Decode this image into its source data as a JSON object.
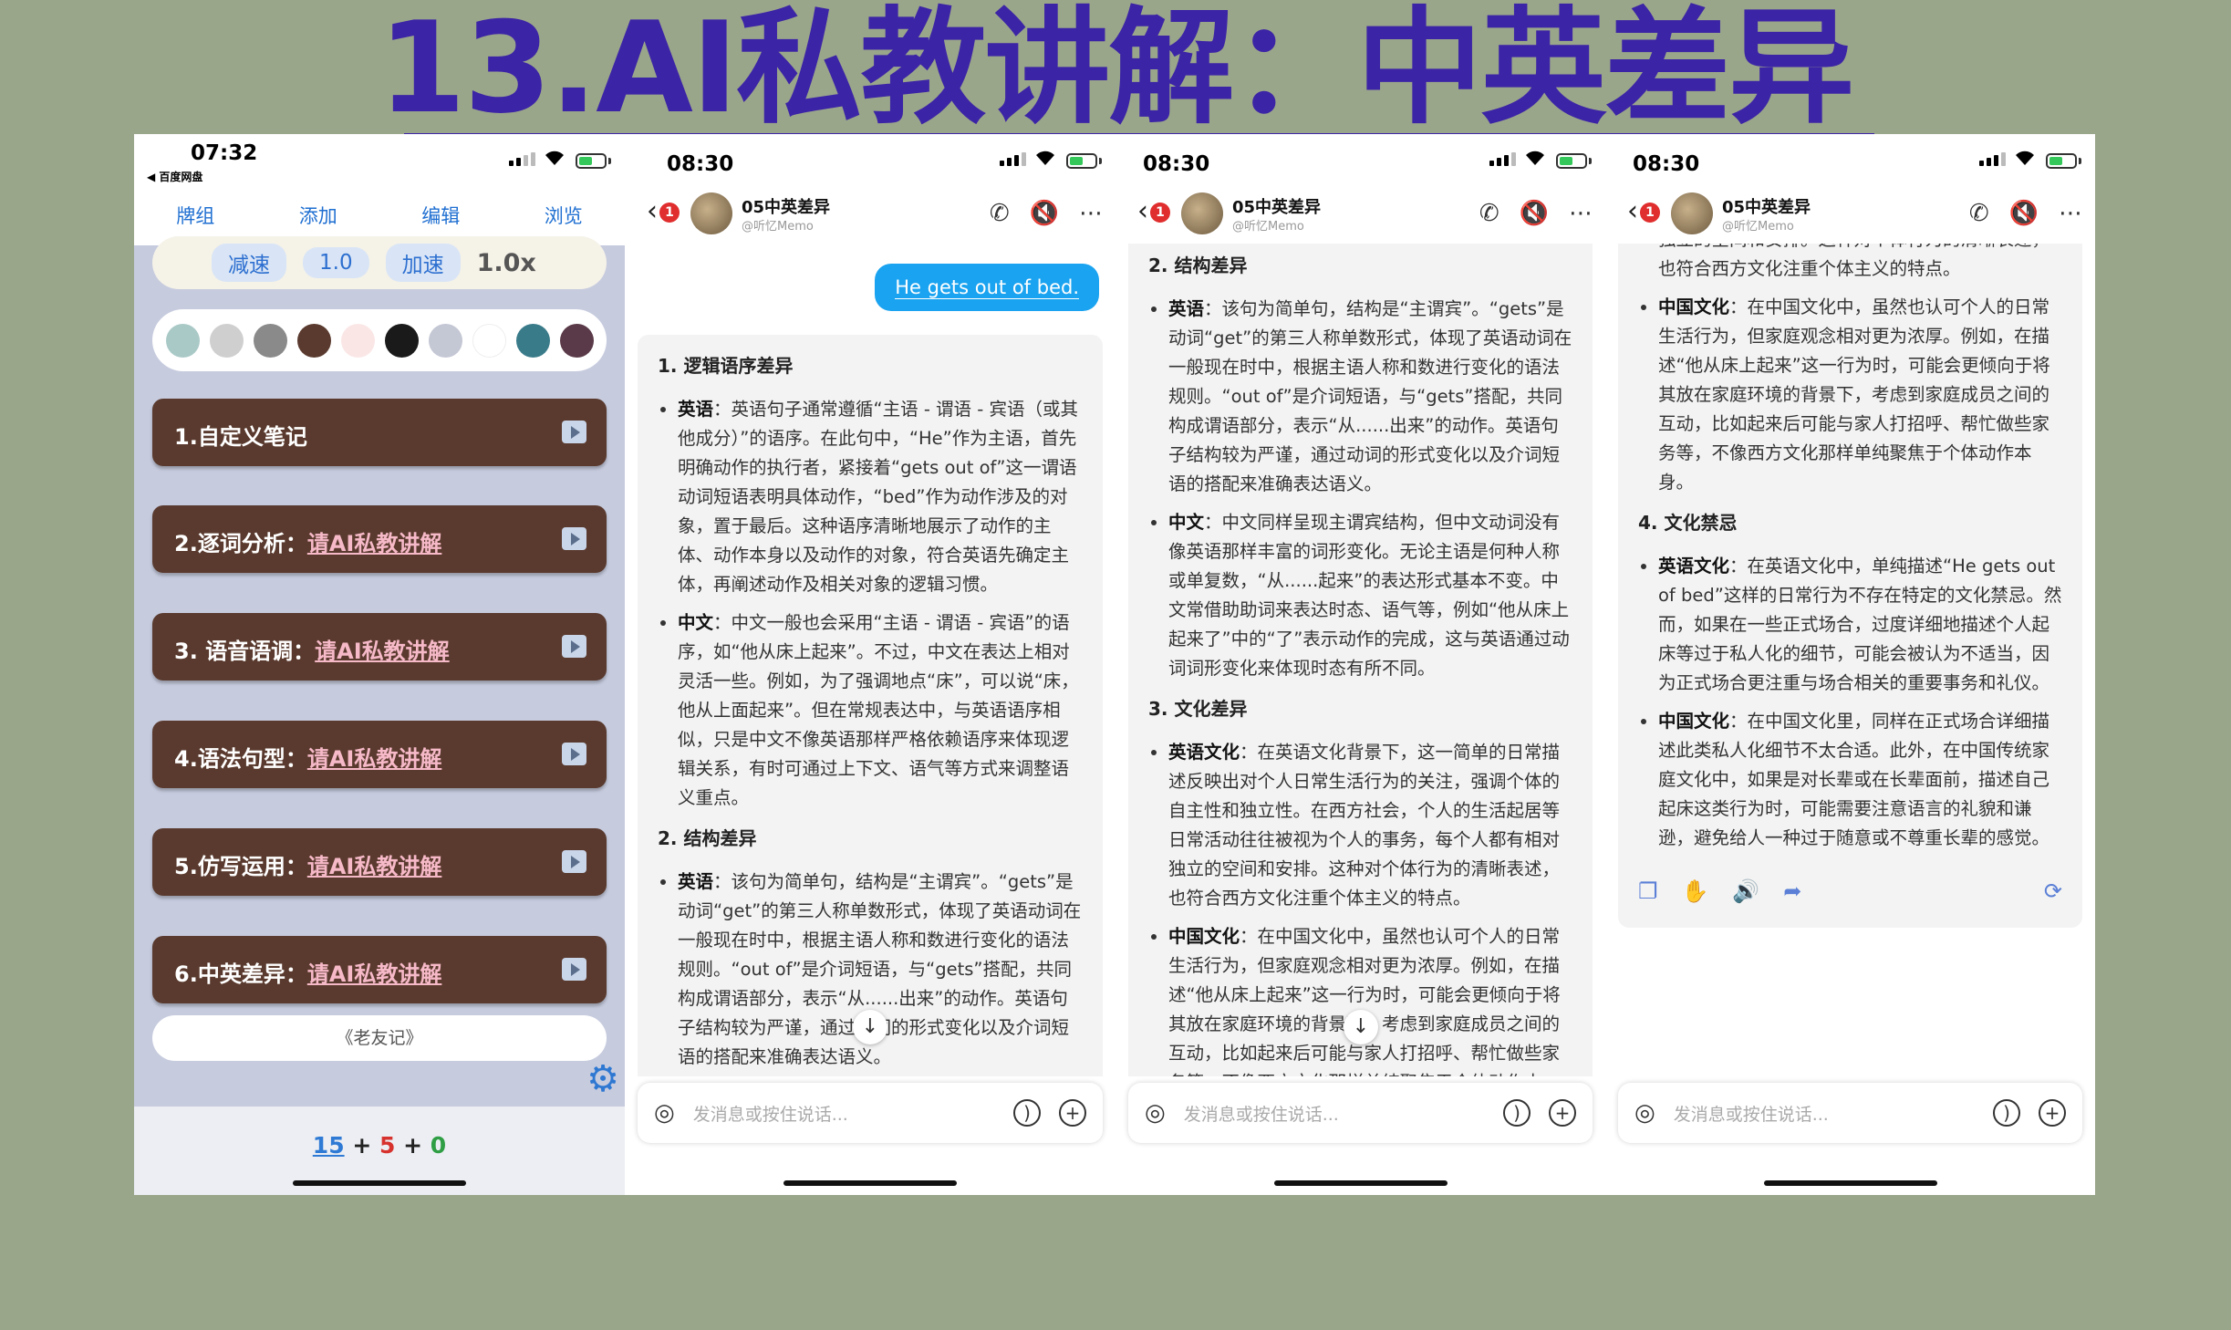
{
  "title": "13.AI私教讲解：中英差异",
  "panel1": {
    "time": "07:32",
    "back_app": "◀ 百度网盘",
    "nav": [
      "牌组",
      "添加",
      "编辑",
      "浏览"
    ],
    "speed": {
      "slow": "减速",
      "value": "1.0",
      "fast": "加速",
      "current": "1.0x"
    },
    "swatch_colors": [
      "#a9c9c7",
      "#cfcfcf",
      "#8a8a8a",
      "#5a3a2e",
      "#fbe6e6",
      "#1a1a1a",
      "#c4c7d4",
      "#ffffff",
      "#3a7b8a",
      "#5a3a48"
    ],
    "cards": [
      {
        "label": "1.自定义笔记",
        "link": ""
      },
      {
        "label": "2.逐词分析：",
        "link": "请AI私教讲解"
      },
      {
        "label": "3. 语音语调：",
        "link": "请AI私教讲解"
      },
      {
        "label": "4.语法句型：",
        "link": "请AI私教讲解"
      },
      {
        "label": "5.仿写运用：",
        "link": "请AI私教讲解"
      },
      {
        "label": "6.中英差异：",
        "link": "请AI私教讲解"
      }
    ],
    "old_friend": "《老友记》",
    "score": {
      "a": "15",
      "b": "5",
      "c": "0",
      "plus": "+"
    }
  },
  "chat": {
    "times": [
      "08:30",
      "08:30",
      "08:30"
    ],
    "badge": "1",
    "name": "05中英差异",
    "handle": "@听忆Memo",
    "input_placeholder": "发消息或按住说话...",
    "user_message": "He gets out of bed.",
    "sections": {
      "s1_title": "1. 逻辑语序差异",
      "s1_en_label": "英语",
      "s1_en": "：英语句子通常遵循“主语 - 谓语 - 宾语（或其他成分）”的语序。在此句中，“He”作为主语，首先明确动作的执行者，紧接着“gets out of”这一谓语动词短语表明具体动作，“bed”作为动作涉及的对象，置于最后。这种语序清晰地展示了动作的主体、动作本身以及动作的对象，符合英语先确定主体，再阐述动作及相关对象的逻辑习惯。",
      "s1_zh_label": "中文",
      "s1_zh": "：中文一般也会采用“主语 - 谓语 - 宾语”的语序，如“他从床上起来”。不过，中文在表达上相对灵活一些。例如，为了强调地点“床”，可以说“床，他从上面起来”。但在常规表达中，与英语语序相似，只是中文不像英语那样严格依赖语序来体现逻辑关系，有时可通过上下文、语气等方式来调整语义重点。",
      "s2_title": "2. 结构差异",
      "s2_en_label": "英语",
      "s2_en": "：该句为简单句，结构是“主谓宾”。“gets”是动词“get”的第三人称单数形式，体现了英语动词在一般现在时中，根据主语人称和数进行变化的语法规则。“out of”是介词短语，与“gets”搭配，共同构成谓语部分，表示“从......出来”的动作。英语句子结构较为严谨，通过动词的形式变化以及介词短语的搭配来准确表达语义。",
      "s2_zh_label": "中文",
      "s2_zh": "：中文同样呈现主谓宾结构，但中文动词没有像英语那样丰富的词形变化。无论主语是何种人称或单复数，“从......起来”的表达形式基本不变。中文常借助助词来表达时态、语气等，例如“他从床上起来了”中的“了”表示动作的完成，这与英语通过动词词形变化来体现时态有所不同。",
      "s3_title": "3. 文化差异",
      "s3_en_label": "英语文化",
      "s3_en": "：在英语文化背景下，这一简单的日常描述反映出对个人日常生活行为的关注，强调个体的自主性和独立性。在西方社会，个人的生活起居等日常活动往往被视为个人的事务，每个人都有相对独立的空间和安排。这种对个体行为的清晰表述，也符合西方文化注重个体主义的特点。",
      "s3_zh_label": "中国文化",
      "s3_zh": "：在中国文化中，虽然也认可个人的日常生活行为，但家庭观念相对更为浓厚。例如，在描述“他从床上起来”这一行为时，可能会更倾向于将其放在家庭环境的背景下，考虑到家庭成员之间的互动，比如起来后可能与家人打招呼、帮忙做些家务等，不像西方文化那样单纯聚焦于个体动作本身。",
      "s4_title": "4. 文化禁忌",
      "s4_en_label": "英语文化",
      "s4_en": "：在英语文化中，单纯描述“He gets out of bed”这样的日常行为不存在特定的文化禁忌。然而，如果在一些正式场合，过度详细地描述个人起床等过于私人化的细节，可能会被认为不适当，因为正式场合更注重与场合相关的重要事务和礼仪。",
      "s4_zh_label": "中国文化",
      "s4_zh": "：在中国文化里，同样在正式场合详细描述此类私人化细节不太合适。此外，在中国传统家庭文化中，如果是对长辈或在长辈面前，描述自己起床这类行为时，可能需要注意语言的礼貌和谦逊，避免给人一种过于随意或不尊重长辈的感觉。"
    }
  }
}
